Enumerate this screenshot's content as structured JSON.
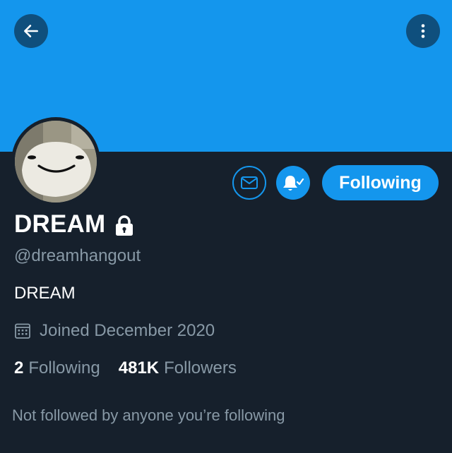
{
  "colors": {
    "banner": "#1496ed",
    "background": "#16202c",
    "accent": "#1496ed",
    "secondary_text": "#8899a6",
    "header_button": "#0f4f7d"
  },
  "header": {
    "back_icon": "arrow-left-icon",
    "more_icon": "more-vertical-icon"
  },
  "actions": {
    "message_icon": "envelope-icon",
    "notification_icon": "bell-check-icon",
    "following_label": "Following"
  },
  "profile": {
    "name": "DREAM",
    "protected_icon": "lock-icon",
    "handle": "@dreamhangout",
    "bio": "DREAM",
    "joined_icon": "calendar-icon",
    "joined": "Joined December 2020",
    "following_count": "2",
    "following_label": "Following",
    "followers_count": "481K",
    "followers_label": "Followers",
    "followed_by": "Not followed by anyone you’re following"
  }
}
